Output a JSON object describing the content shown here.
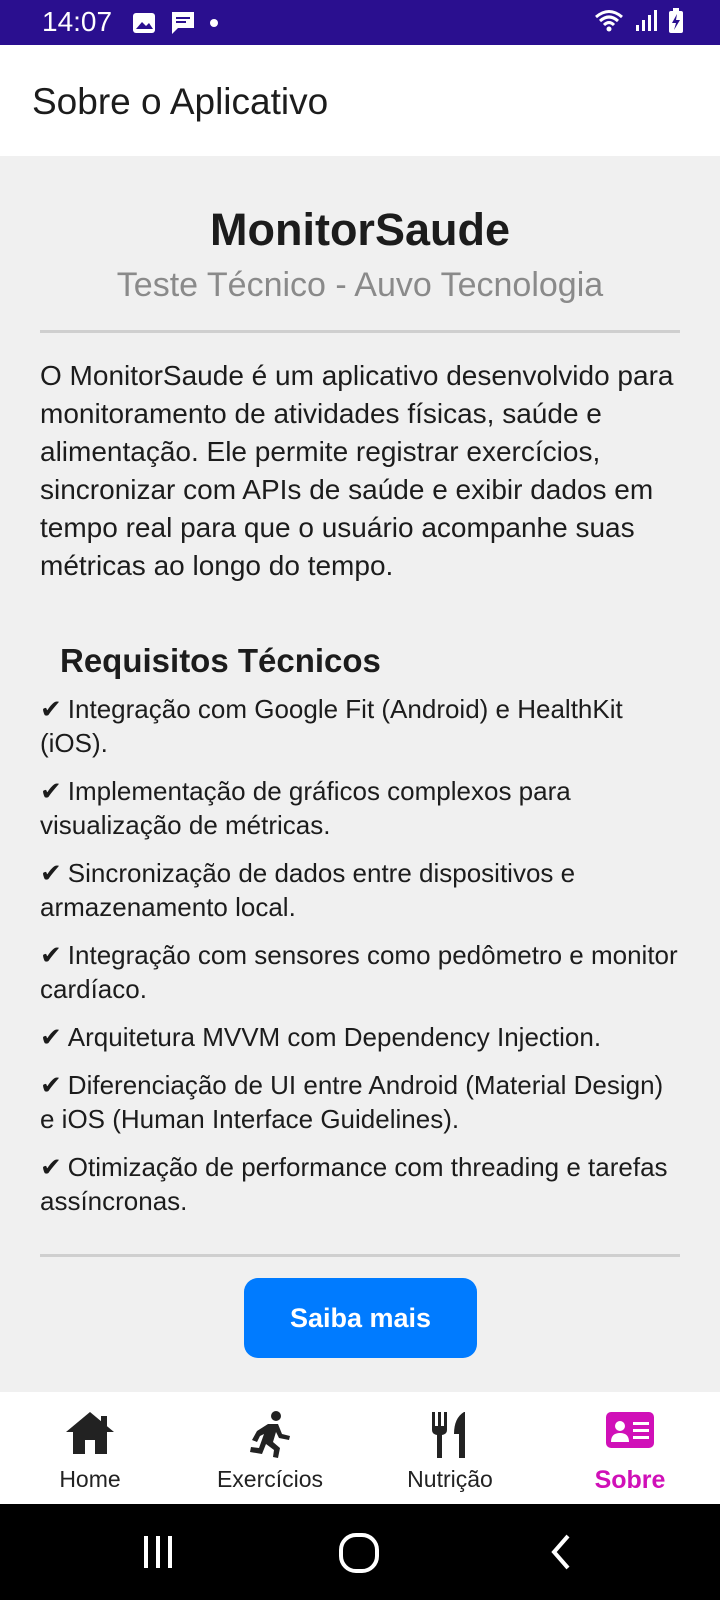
{
  "status_bar": {
    "time": "14:07",
    "left_icons": [
      "image-icon",
      "message-icon",
      "dot-icon"
    ],
    "right_icons": [
      "wifi-icon",
      "signal-icon",
      "battery-charging-icon"
    ]
  },
  "app_bar": {
    "title": "Sobre o Aplicativo"
  },
  "header": {
    "app_name": "MonitorSaude",
    "subtitle": "Teste Técnico - Auvo Tecnologia"
  },
  "description": "O MonitorSaude é um aplicativo desenvolvido para monitoramento de atividades físicas, saúde e alimentação. Ele permite registrar exercícios, sincronizar com APIs de saúde e exibir dados em tempo real para que o usuário acompanhe suas métricas ao longo do tempo.",
  "requirements": {
    "title": "Requisitos Técnicos",
    "items": [
      {
        "check": "✔",
        "text": "Integração com Google Fit (Android) e HealthKit (iOS)."
      },
      {
        "check": "✔",
        "text": "Implementação de gráficos complexos para visualização de métricas."
      },
      {
        "check": "✔",
        "text": "Sincronização de dados entre dispositivos e armazenamento local."
      },
      {
        "check": "✔",
        "text": "Integração com sensores como pedômetro e monitor cardíaco."
      },
      {
        "check": "✔",
        "text": "Arquitetura MVVM com Dependency Injection."
      },
      {
        "check": "✔",
        "text": "Diferenciação de UI entre Android (Material Design) e iOS (Human Interface Guidelines)."
      },
      {
        "check": "✔",
        "text": "Otimização de performance com threading e tarefas assíncronas."
      }
    ]
  },
  "button": {
    "label": "Saiba mais",
    "color": "#007bff"
  },
  "bottom_nav": {
    "active_color": "#d010b8",
    "items": [
      {
        "label": "Home",
        "icon": "home-icon",
        "active": false
      },
      {
        "label": "Exercícios",
        "icon": "running-icon",
        "active": false
      },
      {
        "label": "Nutrição",
        "icon": "utensils-icon",
        "active": false
      },
      {
        "label": "Sobre",
        "icon": "id-card-icon",
        "active": true
      }
    ]
  },
  "system_nav": {
    "icons": [
      "recents-icon",
      "home-circle-icon",
      "back-icon"
    ]
  }
}
